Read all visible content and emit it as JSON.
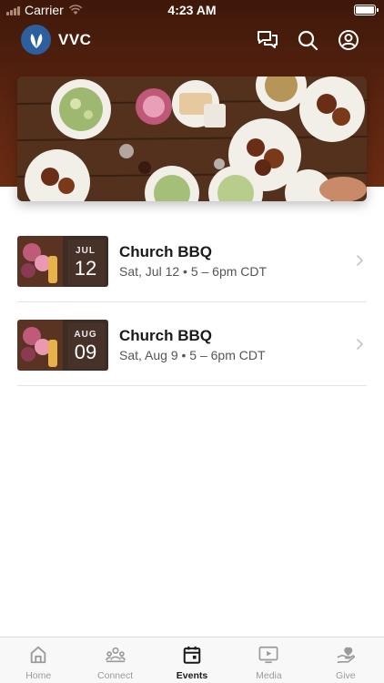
{
  "status_bar": {
    "carrier": "Carrier",
    "time": "4:23 AM"
  },
  "app": {
    "title": "VVC"
  },
  "events": [
    {
      "title": "Church BBQ",
      "month": "JUL",
      "day": "12",
      "subtitle": "Sat, Jul 12 • 5 – 6pm CDT"
    },
    {
      "title": "Church BBQ",
      "month": "AUG",
      "day": "09",
      "subtitle": "Sat, Aug 9 • 5 – 6pm CDT"
    }
  ],
  "tabs": [
    {
      "label": "Home",
      "icon": "home-icon"
    },
    {
      "label": "Connect",
      "icon": "people-icon"
    },
    {
      "label": "Events",
      "icon": "calendar-icon",
      "active": true
    },
    {
      "label": "Media",
      "icon": "play-screen-icon"
    },
    {
      "label": "Give",
      "icon": "heart-hand-icon"
    }
  ],
  "colors": {
    "header": "#5a2410",
    "logo": "#2d5f9e",
    "active_tab": "#1a1a1a",
    "inactive_tab": "#9a9a9a"
  }
}
